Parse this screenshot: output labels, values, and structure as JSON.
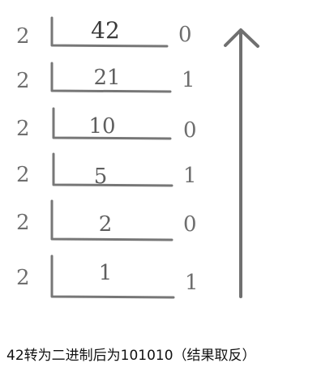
{
  "steps": [
    {
      "divisor": "2",
      "quotient": "42",
      "remainder": "0"
    },
    {
      "divisor": "2",
      "quotient": "21",
      "remainder": "1"
    },
    {
      "divisor": "2",
      "quotient": "10",
      "remainder": "0"
    },
    {
      "divisor": "2",
      "quotient": "5",
      "remainder": "1"
    },
    {
      "divisor": "2",
      "quotient": "2",
      "remainder": "0"
    },
    {
      "divisor": "2",
      "quotient": "1",
      "remainder": "1"
    }
  ],
  "caption": "42转为二进制后为101010（结果取反）",
  "arrow_icon": "up-arrow-icon",
  "colors": {
    "ink": "#6f6f6f",
    "caption": "#111111"
  }
}
